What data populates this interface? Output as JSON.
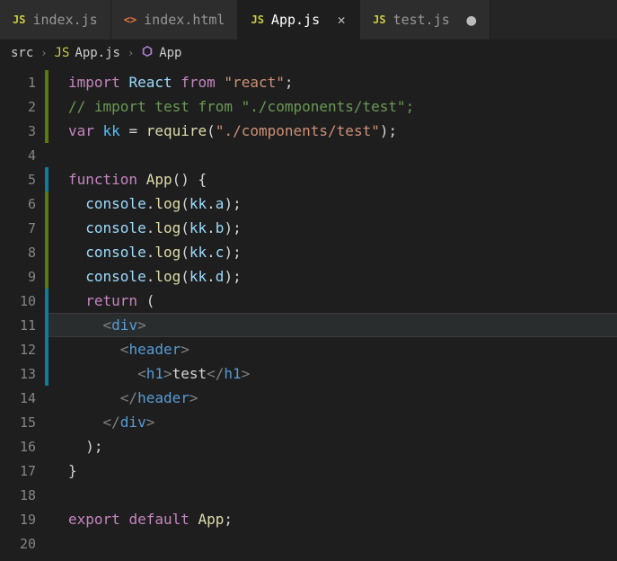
{
  "tabs": [
    {
      "icon": "JS",
      "iconClass": "js-icon",
      "label": "index.js",
      "active": false,
      "dirty": false
    },
    {
      "icon": "<>",
      "iconClass": "html-icon",
      "label": "index.html",
      "active": false,
      "dirty": false
    },
    {
      "icon": "JS",
      "iconClass": "js-icon",
      "label": "App.js",
      "active": true,
      "dirty": false
    },
    {
      "icon": "JS",
      "iconClass": "js-icon",
      "label": "test.js",
      "active": false,
      "dirty": true
    }
  ],
  "breadcrumbs": {
    "seg0": "src",
    "seg1": "App.js",
    "seg2": "App"
  },
  "code": {
    "lines": [
      {
        "n": 1,
        "mod": "add",
        "tokens": [
          [
            "keyword",
            "import"
          ],
          [
            "default",
            " "
          ],
          [
            "var",
            "React"
          ],
          [
            "default",
            " "
          ],
          [
            "keyword",
            "from"
          ],
          [
            "default",
            " "
          ],
          [
            "string",
            "\"react\""
          ],
          [
            "punct",
            ";"
          ]
        ]
      },
      {
        "n": 2,
        "mod": "add",
        "tokens": [
          [
            "comment",
            "// import test from \"./components/test\";"
          ]
        ]
      },
      {
        "n": 3,
        "mod": "add",
        "tokens": [
          [
            "keyword",
            "var"
          ],
          [
            "default",
            " "
          ],
          [
            "object",
            "kk"
          ],
          [
            "default",
            " "
          ],
          [
            "punct",
            "="
          ],
          [
            "default",
            " "
          ],
          [
            "func",
            "require"
          ],
          [
            "punct",
            "("
          ],
          [
            "string",
            "\"./components/test\""
          ],
          [
            "punct",
            ")"
          ],
          [
            "punct",
            ";"
          ]
        ]
      },
      {
        "n": 4,
        "mod": "",
        "tokens": []
      },
      {
        "n": 5,
        "mod": "change",
        "tokens": [
          [
            "keyword",
            "function"
          ],
          [
            "default",
            " "
          ],
          [
            "func",
            "App"
          ],
          [
            "punct",
            "()"
          ],
          [
            "default",
            " "
          ],
          [
            "punct",
            "{"
          ]
        ]
      },
      {
        "n": 6,
        "mod": "add",
        "tokens": [
          [
            "default",
            "  "
          ],
          [
            "var",
            "console"
          ],
          [
            "punct",
            "."
          ],
          [
            "func",
            "log"
          ],
          [
            "punct",
            "("
          ],
          [
            "var",
            "kk"
          ],
          [
            "punct",
            "."
          ],
          [
            "var",
            "a"
          ],
          [
            "punct",
            ")"
          ],
          [
            "punct",
            ";"
          ]
        ]
      },
      {
        "n": 7,
        "mod": "add",
        "tokens": [
          [
            "default",
            "  "
          ],
          [
            "var",
            "console"
          ],
          [
            "punct",
            "."
          ],
          [
            "func",
            "log"
          ],
          [
            "punct",
            "("
          ],
          [
            "var",
            "kk"
          ],
          [
            "punct",
            "."
          ],
          [
            "var",
            "b"
          ],
          [
            "punct",
            ")"
          ],
          [
            "punct",
            ";"
          ]
        ]
      },
      {
        "n": 8,
        "mod": "add",
        "tokens": [
          [
            "default",
            "  "
          ],
          [
            "var",
            "console"
          ],
          [
            "punct",
            "."
          ],
          [
            "func",
            "log"
          ],
          [
            "punct",
            "("
          ],
          [
            "var",
            "kk"
          ],
          [
            "punct",
            "."
          ],
          [
            "var",
            "c"
          ],
          [
            "punct",
            ")"
          ],
          [
            "punct",
            ";"
          ]
        ]
      },
      {
        "n": 9,
        "mod": "add",
        "tokens": [
          [
            "default",
            "  "
          ],
          [
            "var",
            "console"
          ],
          [
            "punct",
            "."
          ],
          [
            "func",
            "log"
          ],
          [
            "punct",
            "("
          ],
          [
            "var",
            "kk"
          ],
          [
            "punct",
            "."
          ],
          [
            "var",
            "d"
          ],
          [
            "punct",
            ")"
          ],
          [
            "punct",
            ";"
          ]
        ]
      },
      {
        "n": 10,
        "mod": "change",
        "tokens": [
          [
            "default",
            "  "
          ],
          [
            "keyword",
            "return"
          ],
          [
            "default",
            " "
          ],
          [
            "punct",
            "("
          ]
        ]
      },
      {
        "n": 11,
        "mod": "change",
        "tokens": [
          [
            "default",
            "    "
          ],
          [
            "tagbr",
            "<"
          ],
          [
            "tag",
            "div"
          ],
          [
            "tagbr",
            ">"
          ]
        ]
      },
      {
        "n": 12,
        "mod": "change",
        "tokens": [
          [
            "default",
            "      "
          ],
          [
            "tagbr",
            "<"
          ],
          [
            "tag",
            "header"
          ],
          [
            "tagbr",
            ">"
          ]
        ]
      },
      {
        "n": 13,
        "mod": "change",
        "tokens": [
          [
            "default",
            "        "
          ],
          [
            "tagbr",
            "<"
          ],
          [
            "tag",
            "h1"
          ],
          [
            "tagbr",
            ">"
          ],
          [
            "default",
            "test"
          ],
          [
            "tagbr",
            "</"
          ],
          [
            "tag",
            "h1"
          ],
          [
            "tagbr",
            ">"
          ]
        ]
      },
      {
        "n": 14,
        "mod": "",
        "tokens": [
          [
            "default",
            "      "
          ],
          [
            "tagbr",
            "</"
          ],
          [
            "tag",
            "header"
          ],
          [
            "tagbr",
            ">"
          ]
        ]
      },
      {
        "n": 15,
        "mod": "",
        "tokens": [
          [
            "default",
            "    "
          ],
          [
            "tagbr",
            "</"
          ],
          [
            "tag",
            "div"
          ],
          [
            "tagbr",
            ">"
          ]
        ]
      },
      {
        "n": 16,
        "mod": "",
        "tokens": [
          [
            "default",
            "  "
          ],
          [
            "punct",
            ")"
          ],
          [
            "punct",
            ";"
          ]
        ]
      },
      {
        "n": 17,
        "mod": "",
        "tokens": [
          [
            "punct",
            "}"
          ]
        ]
      },
      {
        "n": 18,
        "mod": "",
        "tokens": []
      },
      {
        "n": 19,
        "mod": "",
        "tokens": [
          [
            "keyword",
            "export"
          ],
          [
            "default",
            " "
          ],
          [
            "keyword",
            "default"
          ],
          [
            "default",
            " "
          ],
          [
            "func",
            "App"
          ],
          [
            "punct",
            ";"
          ]
        ]
      },
      {
        "n": 20,
        "mod": "",
        "tokens": []
      }
    ]
  },
  "activeLine": 11
}
